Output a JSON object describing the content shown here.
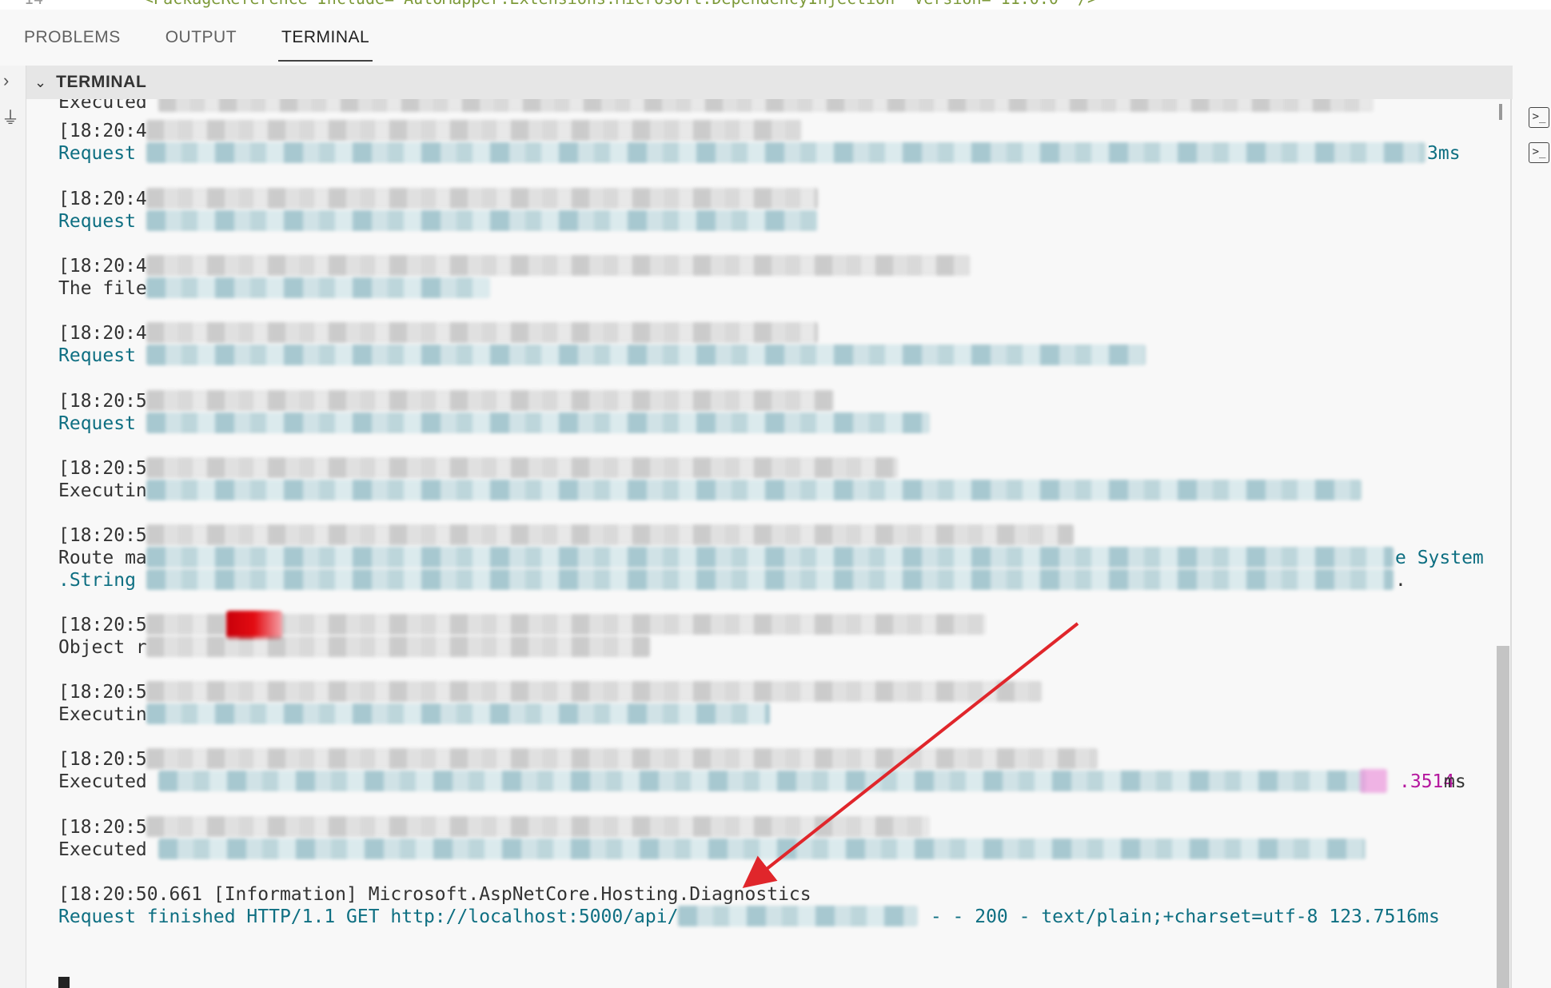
{
  "editor": {
    "line_number": "14",
    "line_text": "<PackageReference Include=\"AutoMapper.Extensions.Microsoft.DependencyInjection\" Version=\"11.0.0\" />"
  },
  "tabs": [
    {
      "label": "PROBLEMS",
      "active": false
    },
    {
      "label": "OUTPUT",
      "active": false
    },
    {
      "label": "TERMINAL",
      "active": true
    }
  ],
  "terminal_section": {
    "title": "TERMINAL"
  },
  "log_lines": {
    "l0": "Executed",
    "l1a": "[18:20:4",
    "l1b": "Request",
    "l1b_tail": "3ms",
    "l2a": "[18:20:4",
    "l2b": "Request",
    "l3a": "[18:20:4",
    "l3b": "The file",
    "l4a": "[18:20:4",
    "l4b": "Request",
    "l5a": "[18:20:5",
    "l5b": "Request",
    "l6a": "[18:20:5",
    "l6b": "Executin",
    "l7a": "[18:20:5",
    "l7b": "Route ma",
    "l7b_tail": "e System",
    "l7c": ".String",
    "l7c_tail": ".",
    "l8a": "[18:20:5",
    "l8b": "Object r",
    "l9a": "[18:20:5",
    "l9b": "Executin",
    "l10a": "[18:20:5",
    "l10b": "Executed",
    "l10b_num": ".3514",
    "l10b_unit": "ms",
    "l11a": "[18:20:5",
    "l11b": "Executed",
    "last_ts": "[18:20:50.661 [Information] Microsoft.AspNetCore.Hosting.Diagnostics",
    "last_msg_a": "Request finished HTTP/1.1 GET http://localhost:5000/api/",
    "last_msg_b": " - - 200 - text/plain;+charset=utf-8 123.7516ms"
  },
  "colors": {
    "message_teal": "#0e6f82",
    "timestamp_gray": "#333333",
    "highlight_magenta": "#b5179e",
    "annotation_red": "#e0262b"
  },
  "icons": [
    "chevron-right-icon",
    "plug-icon",
    "chevron-down-icon",
    "terminal-icon"
  ]
}
